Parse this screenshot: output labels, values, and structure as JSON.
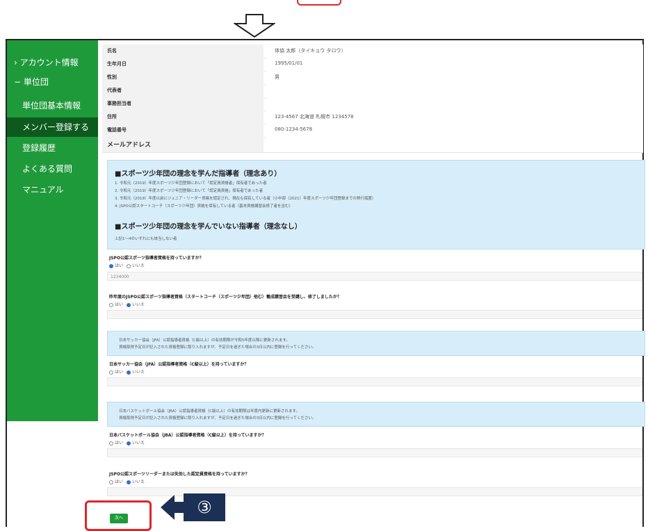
{
  "sidebar": {
    "items": [
      {
        "label": "› アカウント情報"
      },
      {
        "label": "− 単位団"
      },
      {
        "label": "単位団基本情報"
      },
      {
        "label": "メンバー登録する"
      },
      {
        "label": "登録履歴"
      },
      {
        "label": "よくある質問"
      },
      {
        "label": "マニュアル"
      }
    ]
  },
  "info": {
    "rows": [
      {
        "key": "氏名",
        "value": "体協 太郎（タイキョウ タロウ）"
      },
      {
        "key": "生年月日",
        "value": "1995/01/01"
      },
      {
        "key": "性別",
        "value": "男"
      },
      {
        "key": "代表者",
        "value": ""
      },
      {
        "key": "事務担当者",
        "value": ""
      },
      {
        "key": "住所",
        "value": "123-4567 北海道 札幌市 1234578"
      },
      {
        "key": "電話番号",
        "value": "080-1234-5678"
      },
      {
        "key": "メールアドレス",
        "value": ""
      }
    ]
  },
  "notice": {
    "heading1": "■スポーツ少年団の理念を学んだ指導者（理念あり）",
    "lines": [
      "1. 令和元（2019）年度スポーツ少年団登録において「認定員資格者」保有者であった者",
      "2. 令和元（2019）年度スポーツ少年団登録において「認定員資格」保有者であった者",
      "3. 令和元（2019）年度以前にジュニア・リーダー資格を認定され、現在も保有している者（小中部（2021）年度スポーツ少年団登録までの移行措置）",
      "4. JSPO公認スタートコーチ（スポーツ少年団）資格を保有している者（基本資格講習会修了者を含む）"
    ],
    "heading2": "■スポーツ少年団の理念を学んでいない指導者（理念なし）",
    "line2": "上記1〜4のいずれにも該当しない者"
  },
  "questions": [
    {
      "text": "JSPO公認スポーツ指導者資格を持っていますか？",
      "opt_yes": "はい",
      "opt_no": "いいえ",
      "value": "1234000"
    },
    {
      "text": "昨年度のJSPO公認スポーツ指導者資格（スタートコーチ（スポーツ少年団）他む）養成講習会を受講し、修了しましたか？",
      "opt_yes": "はい",
      "opt_no": "いいえ",
      "value": ""
    },
    {
      "text": "日本サッカー協会（JFA）公認指導者資格（C級以上）を持っていますか？",
      "opt_yes": "はい",
      "opt_no": "いいえ",
      "value": ""
    },
    {
      "text": "日本バスケットボール協会（JBA）公認指導者資格（C級以上）を持っていますか？",
      "opt_yes": "はい",
      "opt_no": "いいえ",
      "value": ""
    },
    {
      "text": "JSPO公認スポーツリーダーまたは失効した認定員資格を持っていますか？",
      "opt_yes": "はい",
      "opt_no": "いいえ",
      "value": ""
    }
  ],
  "info_boxes": [
    {
      "l1": "日本サッカー協会（JFA）公認指導者資格（C級以上）の有効期限が令和5年度以降に更新されます。",
      "l2": "資格取得予定日が記入された資格登録に取り入れますが、予定日を過ぎた場合の3日以内に登録を行ってください。"
    },
    {
      "l1": "日本バスケットボール協会（JBA）公認指導者資格（C級以上）の有効期限は年度内更新に更新されます。",
      "l2": "資格取得予定日が記入された資格登録に取り入れますが、予定日を過ぎた場合の3日以内に登録を行ってください。"
    }
  ],
  "next_button": "次へ",
  "callout": "③"
}
